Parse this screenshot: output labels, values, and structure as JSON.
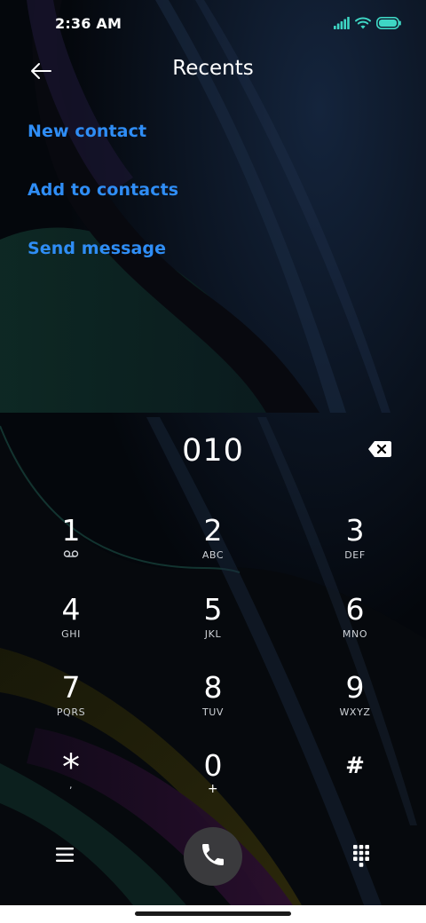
{
  "status_bar": {
    "time": "2:36 AM"
  },
  "header": {
    "title": "Recents"
  },
  "actions": [
    {
      "label": "New contact"
    },
    {
      "label": "Add to contacts"
    },
    {
      "label": "Send message"
    }
  ],
  "dialer": {
    "number": "010"
  },
  "keypad": [
    {
      "digit": "1",
      "letters": ""
    },
    {
      "digit": "2",
      "letters": "ABC"
    },
    {
      "digit": "3",
      "letters": "DEF"
    },
    {
      "digit": "4",
      "letters": "GHI"
    },
    {
      "digit": "5",
      "letters": "JKL"
    },
    {
      "digit": "6",
      "letters": "MNO"
    },
    {
      "digit": "7",
      "letters": "PQRS"
    },
    {
      "digit": "8",
      "letters": "TUV"
    },
    {
      "digit": "9",
      "letters": "WXYZ"
    },
    {
      "digit": "*",
      "letters": ","
    },
    {
      "digit": "0",
      "letters": "+"
    },
    {
      "digit": "#",
      "letters": ""
    }
  ],
  "colors": {
    "accent": "#2f8df5",
    "background": "#000000",
    "call_button": "#3a3a3d",
    "battery": "#3ed6c4"
  },
  "icons": {
    "back": "arrow-left-icon",
    "signal": "signal-bars-icon",
    "wifi": "wifi-icon",
    "battery": "battery-icon",
    "backspace": "backspace-icon",
    "voicemail": "voicemail-icon",
    "menu": "menu-icon",
    "call": "phone-icon",
    "dialpad": "dialpad-icon"
  }
}
